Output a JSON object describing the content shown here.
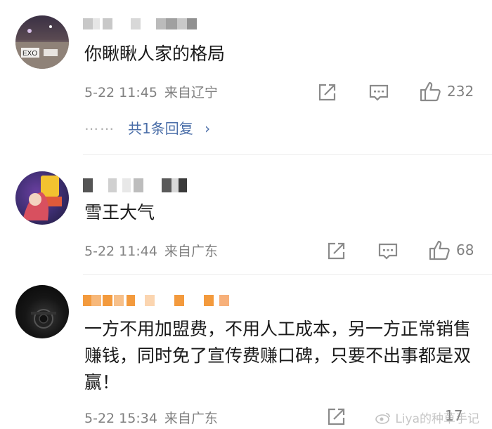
{
  "comments": [
    {
      "text": "你瞅瞅人家的格局",
      "date": "5-22 11:45",
      "location": "来自辽宁",
      "likes": "232",
      "replies": "共1条回复",
      "replies_chevron": "›",
      "dots": "⋯⋯",
      "avatar_text": "EXO"
    },
    {
      "text": "雪王大气",
      "date": "5-22 11:44",
      "location": "来自广东",
      "likes": "68"
    },
    {
      "text": "一方不用加盟费，不用人工成本，另一方正常销售赚钱，同时免了宣传费赚口碑，只要不出事都是双赢！",
      "date": "5-22 15:34",
      "location": "来自广东",
      "likes": "17"
    }
  ],
  "watermark": "Liya的种草手记",
  "colors": {
    "reply_link": "#4a6ea8",
    "meta": "#808080",
    "name_blocks_1": "#bdbdbd",
    "name_blocks_3": "#f39a3d"
  },
  "icons": [
    "share-icon",
    "comment-icon",
    "like-icon",
    "chevron-right-icon"
  ]
}
